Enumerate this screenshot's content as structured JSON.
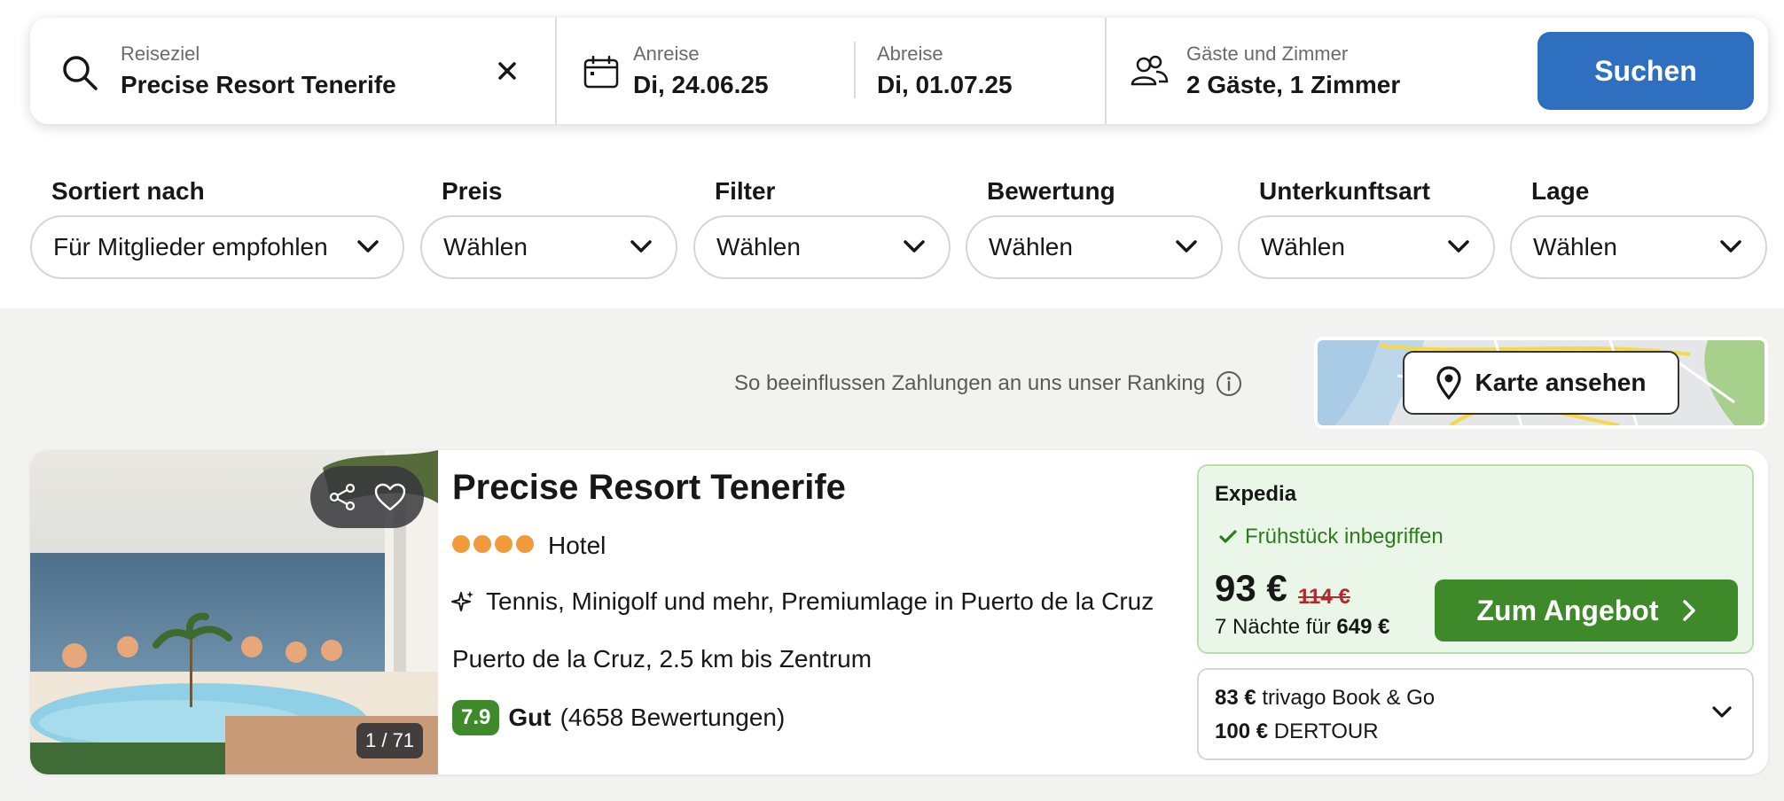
{
  "search": {
    "destination_label": "Reiseziel",
    "destination_value": "Precise Resort Tenerife",
    "checkin_label": "Anreise",
    "checkin_value": "Di, 24.06.25",
    "checkout_label": "Abreise",
    "checkout_value": "Di, 01.07.25",
    "guests_label": "Gäste und Zimmer",
    "guests_value": "2 Gäste, 1 Zimmer",
    "search_button": "Suchen"
  },
  "filters": [
    {
      "title": "Sortiert nach",
      "value": "Für Mitglieder empfohlen"
    },
    {
      "title": "Preis",
      "value": "Wählen"
    },
    {
      "title": "Filter",
      "value": "Wählen"
    },
    {
      "title": "Bewertung",
      "value": "Wählen"
    },
    {
      "title": "Unterkunftsart",
      "value": "Wählen"
    },
    {
      "title": "Lage",
      "value": "Wählen"
    }
  ],
  "ranking_note": "So beeinflussen Zahlungen an uns unser Ranking",
  "map_button": "Karte ansehen",
  "hotel": {
    "name": "Precise Resort Tenerife",
    "stars": 4,
    "type": "Hotel",
    "feature": "Tennis, Minigolf und mehr, Premiumlage in Puerto de la Cruz",
    "location": "Puerto de la Cruz, 2.5 km bis Zentrum",
    "rating_score": "7.9",
    "rating_word": "Gut",
    "rating_count": "(4658 Bewertungen)",
    "photo_counter": "1 / 71"
  },
  "deal": {
    "provider": "Expedia",
    "included": "Frühstück inbegriffen",
    "price": "93 €",
    "old_price": "114 €",
    "total_prefix": "7 Nächte für",
    "total_value": "649 €",
    "button": "Zum Angebot"
  },
  "other_offers": [
    {
      "price": "83 €",
      "provider": "trivago Book & Go"
    },
    {
      "price": "100 €",
      "provider": "DERTOUR"
    }
  ],
  "colors": {
    "search_button": "#2e6fbf",
    "deal_button": "#3e8a2b",
    "rating_badge": "#3e8a2b",
    "stars": "#f29b3c",
    "old_price": "#b22a2a"
  }
}
